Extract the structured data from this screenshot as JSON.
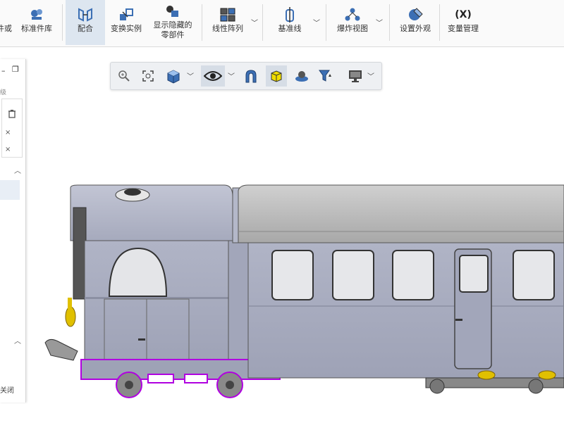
{
  "ribbon": {
    "items": [
      {
        "label": "件或"
      },
      {
        "label": "标准件库"
      },
      {
        "label": "配合"
      },
      {
        "label": "变换实例"
      },
      {
        "label": "显示隐藏的"
      },
      {
        "label": "零部件"
      },
      {
        "label": "线性阵列"
      },
      {
        "label": "基准线"
      },
      {
        "label": "爆炸视图"
      },
      {
        "label": "设置外观"
      },
      {
        "label": "变量管理"
      }
    ],
    "variables_symbol": "(X)",
    "dropdown_glyph": "﹀"
  },
  "side_panel": {
    "label_fragment": "级",
    "close_fragment": "关闭",
    "remove_glyph": "×"
  },
  "colors": {
    "accent": "#3c6fb4",
    "selection": "#b000e0",
    "model_body": "#a9adc0",
    "model_roof": "#bcbcbc",
    "toolbar_bg": "#eef0f3"
  }
}
